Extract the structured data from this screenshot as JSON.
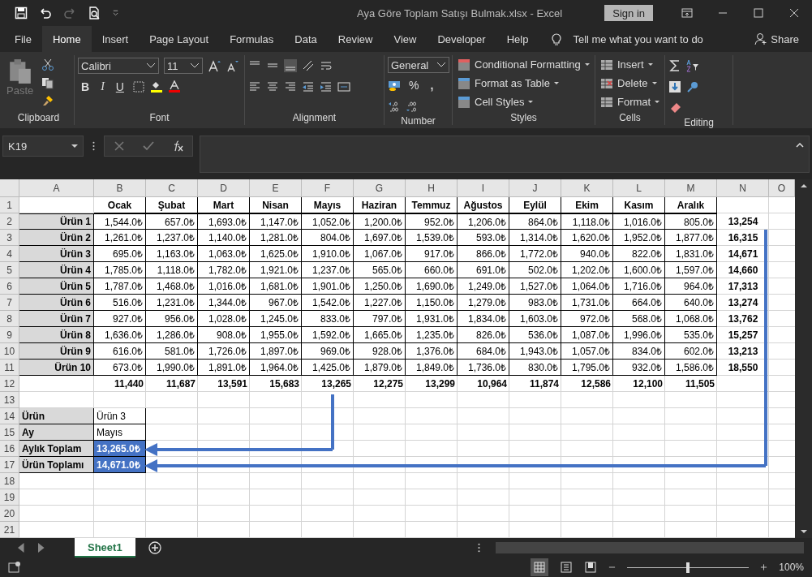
{
  "title_bar": {
    "title": "Aya Göre Toplam Satışı Bulmak.xlsx  -  Excel",
    "sign_in": "Sign in"
  },
  "menu_tabs": [
    {
      "label": "File",
      "selected": false
    },
    {
      "label": "Home",
      "selected": true
    },
    {
      "label": "Insert",
      "selected": false
    },
    {
      "label": "Page Layout",
      "selected": false
    },
    {
      "label": "Formulas",
      "selected": false
    },
    {
      "label": "Data",
      "selected": false
    },
    {
      "label": "Review",
      "selected": false
    },
    {
      "label": "View",
      "selected": false
    },
    {
      "label": "Developer",
      "selected": false
    },
    {
      "label": "Help",
      "selected": false
    }
  ],
  "tell_me": "Tell me what you want to do",
  "share": "Share",
  "ribbon": {
    "clipboard": {
      "paste": "Paste",
      "label": "Clipboard"
    },
    "font": {
      "name": "Calibri",
      "size": "11",
      "bold": "B",
      "italic": "I",
      "underline": "U",
      "label": "Font"
    },
    "alignment": {
      "label": "Alignment"
    },
    "number": {
      "format": "General",
      "percent": "%",
      "comma": ",",
      "label": "Number"
    },
    "styles": {
      "items": [
        "Conditional Formatting",
        "Format as Table",
        "Cell Styles"
      ],
      "label": "Styles"
    },
    "cells": {
      "items": [
        "Insert",
        "Delete",
        "Format"
      ],
      "label": "Cells"
    },
    "editing": {
      "label": "Editing"
    }
  },
  "formula_bar": {
    "name_box": "K19"
  },
  "sheet": {
    "row_numbers": [
      "1",
      "2",
      "3",
      "4",
      "5",
      "6",
      "7",
      "8",
      "9",
      "10",
      "11",
      "12",
      "13",
      "14",
      "15",
      "16",
      "17",
      "18",
      "19",
      "20",
      "21"
    ],
    "columns": [
      "A",
      "B",
      "C",
      "D",
      "E",
      "F",
      "G",
      "H",
      "I",
      "J",
      "K",
      "L",
      "M",
      "N",
      "O"
    ],
    "months": [
      "Ocak",
      "Şubat",
      "Mart",
      "Nisan",
      "Mayıs",
      "Haziran",
      "Temmuz",
      "Ağustos",
      "Eylül",
      "Ekim",
      "Kasım",
      "Aralık"
    ],
    "products": [
      {
        "name": "Ürün 1",
        "values": [
          "1,544.0₺",
          "657.0₺",
          "1,693.0₺",
          "1,147.0₺",
          "1,052.0₺",
          "1,200.0₺",
          "952.0₺",
          "1,206.0₺",
          "864.0₺",
          "1,118.0₺",
          "1,016.0₺",
          "805.0₺"
        ],
        "total": "13,254"
      },
      {
        "name": "Ürün 2",
        "values": [
          "1,261.0₺",
          "1,237.0₺",
          "1,140.0₺",
          "1,281.0₺",
          "804.0₺",
          "1,697.0₺",
          "1,539.0₺",
          "593.0₺",
          "1,314.0₺",
          "1,620.0₺",
          "1,952.0₺",
          "1,877.0₺"
        ],
        "total": "16,315"
      },
      {
        "name": "Ürün 3",
        "values": [
          "695.0₺",
          "1,163.0₺",
          "1,063.0₺",
          "1,625.0₺",
          "1,910.0₺",
          "1,067.0₺",
          "917.0₺",
          "866.0₺",
          "1,772.0₺",
          "940.0₺",
          "822.0₺",
          "1,831.0₺"
        ],
        "total": "14,671"
      },
      {
        "name": "Ürün 4",
        "values": [
          "1,785.0₺",
          "1,118.0₺",
          "1,782.0₺",
          "1,921.0₺",
          "1,237.0₺",
          "565.0₺",
          "660.0₺",
          "691.0₺",
          "502.0₺",
          "1,202.0₺",
          "1,600.0₺",
          "1,597.0₺"
        ],
        "total": "14,660"
      },
      {
        "name": "Ürün 5",
        "values": [
          "1,787.0₺",
          "1,468.0₺",
          "1,016.0₺",
          "1,681.0₺",
          "1,901.0₺",
          "1,250.0₺",
          "1,690.0₺",
          "1,249.0₺",
          "1,527.0₺",
          "1,064.0₺",
          "1,716.0₺",
          "964.0₺"
        ],
        "total": "17,313"
      },
      {
        "name": "Ürün 6",
        "values": [
          "516.0₺",
          "1,231.0₺",
          "1,344.0₺",
          "967.0₺",
          "1,542.0₺",
          "1,227.0₺",
          "1,150.0₺",
          "1,279.0₺",
          "983.0₺",
          "1,731.0₺",
          "664.0₺",
          "640.0₺"
        ],
        "total": "13,274"
      },
      {
        "name": "Ürün 7",
        "values": [
          "927.0₺",
          "956.0₺",
          "1,028.0₺",
          "1,245.0₺",
          "833.0₺",
          "797.0₺",
          "1,931.0₺",
          "1,834.0₺",
          "1,603.0₺",
          "972.0₺",
          "568.0₺",
          "1,068.0₺"
        ],
        "total": "13,762"
      },
      {
        "name": "Ürün 8",
        "values": [
          "1,636.0₺",
          "1,286.0₺",
          "908.0₺",
          "1,955.0₺",
          "1,592.0₺",
          "1,665.0₺",
          "1,235.0₺",
          "826.0₺",
          "536.0₺",
          "1,087.0₺",
          "1,996.0₺",
          "535.0₺"
        ],
        "total": "15,257"
      },
      {
        "name": "Ürün 9",
        "values": [
          "616.0₺",
          "581.0₺",
          "1,726.0₺",
          "1,897.0₺",
          "969.0₺",
          "928.0₺",
          "1,376.0₺",
          "684.0₺",
          "1,943.0₺",
          "1,057.0₺",
          "834.0₺",
          "602.0₺"
        ],
        "total": "13,213"
      },
      {
        "name": "Ürün 10",
        "values": [
          "673.0₺",
          "1,990.0₺",
          "1,891.0₺",
          "1,964.0₺",
          "1,425.0₺",
          "1,879.0₺",
          "1,849.0₺",
          "1,736.0₺",
          "830.0₺",
          "1,795.0₺",
          "932.0₺",
          "1,586.0₺"
        ],
        "total": "18,550"
      }
    ],
    "month_totals": [
      "11,440",
      "11,687",
      "13,591",
      "15,683",
      "13,265",
      "12,275",
      "13,299",
      "10,964",
      "11,874",
      "12,586",
      "12,100",
      "11,505"
    ],
    "lookup": [
      {
        "label": "Ürün",
        "value": "Ürün 3",
        "highlighted": false
      },
      {
        "label": "Ay",
        "value": "Mayıs",
        "highlighted": false
      },
      {
        "label": "Aylık Toplam",
        "value": "13,265.0₺",
        "highlighted": true
      },
      {
        "label": "Ürün Toplamı",
        "value": "14,671.0₺",
        "highlighted": true
      }
    ]
  },
  "sheet_tabs": [
    {
      "label": "Sheet1",
      "selected": true
    }
  ],
  "status_bar": {
    "zoom": "100%",
    "level": 0.5
  }
}
